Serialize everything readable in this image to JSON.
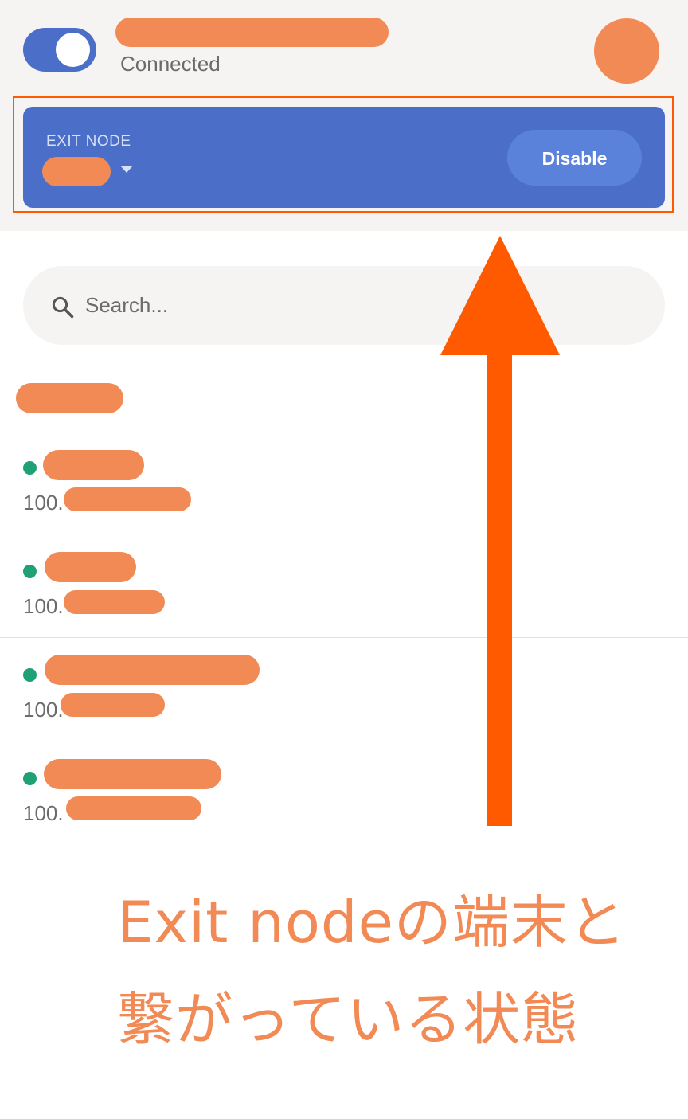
{
  "header": {
    "status": "Connected",
    "toggle_on": true
  },
  "exit_node": {
    "label": "EXIT NODE",
    "disable_label": "Disable"
  },
  "search": {
    "placeholder": "Search..."
  },
  "devices": [
    {
      "ip_prefix": "100.",
      "online": true
    },
    {
      "ip_prefix": "100.",
      "online": true
    },
    {
      "ip_prefix": "100.",
      "online": true
    },
    {
      "ip_prefix": "100.",
      "online": true
    }
  ],
  "annotation": {
    "line1": "Exit nodeの端末と",
    "line2": "繋がっている状態"
  },
  "colors": {
    "accent": "#4b6fc9",
    "button": "#5b82db",
    "redaction": "#f28a55",
    "arrow": "#ff5a00",
    "online": "#20a174"
  }
}
